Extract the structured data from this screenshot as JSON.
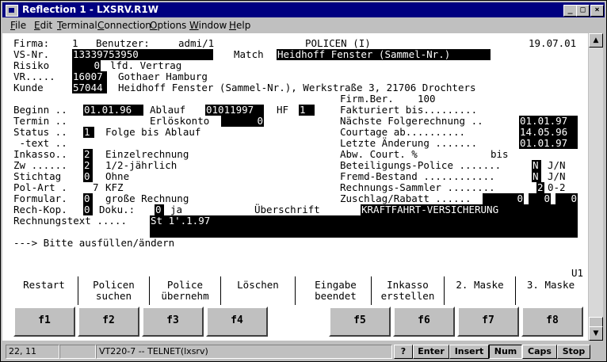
{
  "window": {
    "title": "Reflection 1 - LXSRV.R1W",
    "minimize": "_",
    "maximize": "□",
    "close": "×"
  },
  "menu": [
    "File",
    "Edit",
    "Terminal",
    "Connection",
    "Options",
    "Window",
    "Help"
  ],
  "screen": {
    "firma_label": "Firma:",
    "firma": "1",
    "benutzer_label": "Benutzer:",
    "benutzer": "admi/1",
    "heading": "POLICEN (I)",
    "date": "19.07.01",
    "vsnr_label": "VS-Nr.",
    "vsnr": "13339753950",
    "match_label": "Match",
    "match": "Heidhoff Fenster (Sammel-Nr.)",
    "risiko_label": "Risiko",
    "risiko": "0",
    "risiko_text": "lfd. Vertrag",
    "vr_label": "VR.....",
    "vr": "16007",
    "vr_text": "Gothaer Hamburg",
    "kunde_label": "Kunde",
    "kunde": "57044",
    "kunde_text": "Heidhoff Fenster (Sammel-Nr.), Werkstraße 3, 21706 Drochters",
    "firmber_label": "Firm.Ber.",
    "firmber": "100",
    "beginn_label": "Beginn ..",
    "beginn": "01.01.96",
    "ablauf_label": "Ablauf",
    "ablauf": "01011997",
    "hf_label": "HF",
    "hf": "1",
    "fakturiert_label": "Fakturiert bis.........",
    "termin_label": "Termin ..",
    "erloskonto_label": "Erlöskonto",
    "erloskonto": "0",
    "naechste_label": "Nächste Folgerechnung ..",
    "naechste": "01.01.97",
    "status_label": "Status ..",
    "status": "1",
    "status_text": "Folge bis Ablauf",
    "courtage_label": "Courtage ab..........",
    "courtage": "14.05.96",
    "text_label": " -text ..",
    "letzte_label": "Letzte Änderung .......",
    "letzte": "01.01.97",
    "inkasso_label": "Inkasso..",
    "inkasso": "2",
    "inkasso_text": "Einzelrechnung",
    "abw_label": "Abw. Court. %",
    "bis_label": "bis",
    "zw_label": "Zw ......",
    "zw": "2",
    "zw_text": "1/2-jährlich",
    "beteiligung_label": "Beteiligungs-Police .......",
    "beteiligung": "N",
    "beteiligung_hint": "J/N",
    "stichtag_label": "Stichtag",
    "stichtag": "0",
    "stichtag_text": "Ohne",
    "fremd_label": "Fremd-Bestand ............",
    "fremd": "N",
    "fremd_hint": "J/N",
    "polart_label": "Pol-Art .",
    "polart": "7",
    "polart_text": "KFZ",
    "sammler_label": "Rechnungs-Sammler ........",
    "sammler": "2",
    "sammler_hint": "0-2",
    "formular_label": "Formular.",
    "formular": "0",
    "formular_text": "große Rechnung",
    "zuschlag_label": "Zuschlag/Rabatt ......",
    "zuschlag1": "0",
    "zuschlag2": "0",
    "zuschlag3": "0",
    "rechkop_label": "Rech-Kop.",
    "rechkop": "0",
    "doku_label": "Doku.:",
    "doku": "0",
    "doku_text": "ja",
    "ueberschrift_label": "Überschrift",
    "ueberschrift": "KRAFTFAHRT-VERSICHERUNG",
    "rechtext_label": "Rechnungstext .....",
    "rechtext": "St 1'.1.97",
    "prompt": "---> Bitte ausfüllen/ändern",
    "page_id": "U1"
  },
  "function_labels": [
    {
      "line1": "Restart",
      "line2": ""
    },
    {
      "line1": "Policen",
      "line2": "suchen"
    },
    {
      "line1": "Police",
      "line2": "übernehm"
    },
    {
      "line1": "Löschen",
      "line2": ""
    },
    {
      "line1": "Eingabe",
      "line2": "beendet"
    },
    {
      "line1": "Inkasso",
      "line2": "erstellen"
    },
    {
      "line1": "2. Maske",
      "line2": ""
    },
    {
      "line1": "3. Maske",
      "line2": ""
    }
  ],
  "function_keys": [
    "f1",
    "f2",
    "f3",
    "f4",
    "f5",
    "f6",
    "f7",
    "f8"
  ],
  "statusbar": {
    "cursor": "22, 11",
    "session": "VT220-7 -- TELNET(lxsrv)",
    "help": "?",
    "enter": "Enter",
    "insert": "Insert",
    "num": "Num",
    "caps": "Caps",
    "stop": "Stop"
  }
}
